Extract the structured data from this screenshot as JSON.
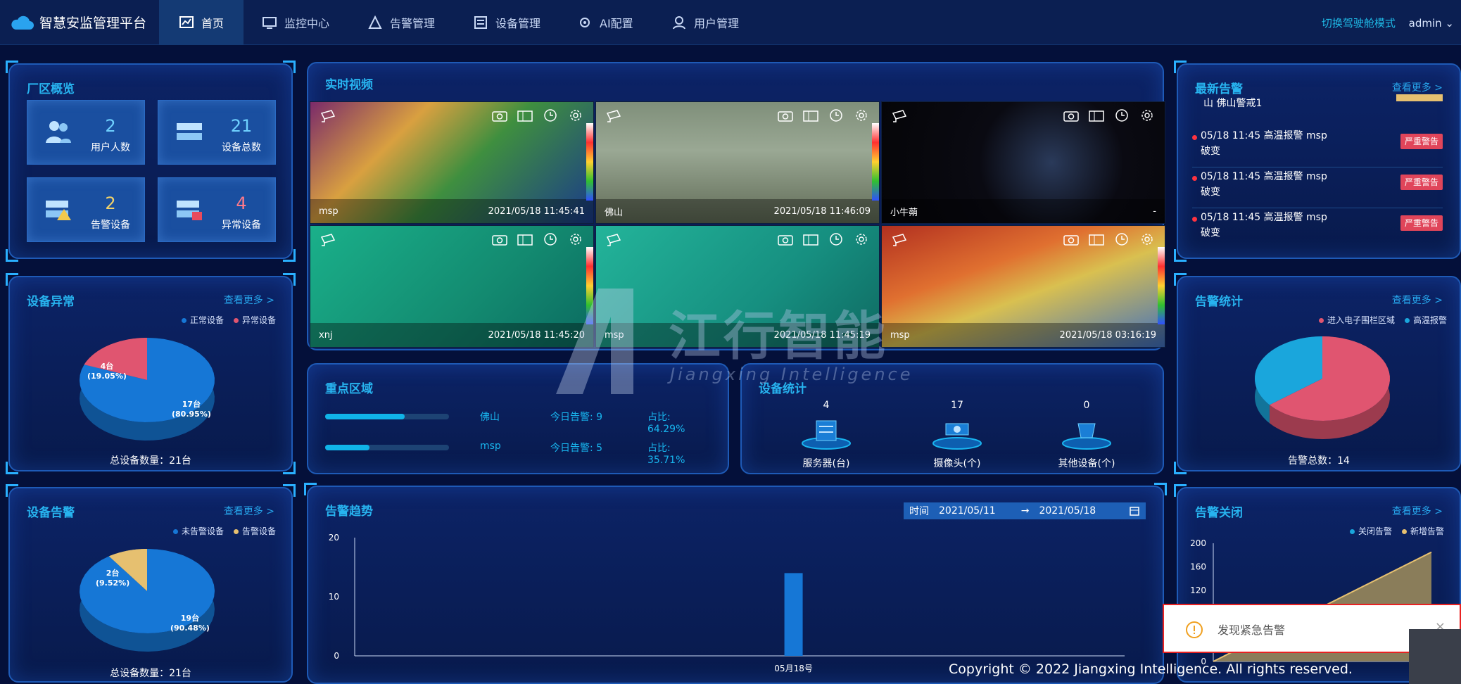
{
  "nav": {
    "brand": "智慧安监管理平台",
    "items": [
      "首页",
      "监控中心",
      "告警管理",
      "设备管理",
      "AI配置",
      "用户管理"
    ],
    "mode_link": "切换驾驶舱模式",
    "user": "admin"
  },
  "factory_overview": {
    "title": "厂区概览",
    "cards": [
      {
        "num": "2",
        "label": "用户人数"
      },
      {
        "num": "21",
        "label": "设备总数"
      },
      {
        "num": "2",
        "label": "告警设备"
      },
      {
        "num": "4",
        "label": "异常设备"
      }
    ]
  },
  "device_abnormal": {
    "title": "设备异常",
    "more": "查看更多 >",
    "legend": [
      "正常设备",
      "异常设备"
    ],
    "slices": [
      {
        "label": "4台",
        "pct": "(19.05%)"
      },
      {
        "label": "17台",
        "pct": "(80.95%)"
      }
    ],
    "total": "总设备数量：21台"
  },
  "device_alarm": {
    "title": "设备告警",
    "more": "查看更多 >",
    "legend": [
      "未告警设备",
      "告警设备"
    ],
    "slices": [
      {
        "label": "2台",
        "pct": "(9.52%)"
      },
      {
        "label": "19台",
        "pct": "(90.48%)"
      }
    ],
    "total": "总设备数量：21台"
  },
  "realtime_video": {
    "title": "实时视频",
    "videos": [
      {
        "name": "msp",
        "time": "2021/05/18 11:45:41"
      },
      {
        "name": "佛山",
        "time": "2021/05/18 11:46:09"
      },
      {
        "name": "小牛蒴",
        "time": "-"
      },
      {
        "name": "xnj",
        "time": "2021/05/18 11:45:20"
      },
      {
        "name": "msp",
        "time": "2021/05/18 11:45:19"
      },
      {
        "name": "msp",
        "time": "2021/05/18 03:16:19"
      }
    ]
  },
  "key_area": {
    "title": "重点区域",
    "rows": [
      {
        "name": "佛山",
        "today": "今日告警: 9",
        "pct": "占比: 64.29%",
        "fill": 0.6429
      },
      {
        "name": "msp",
        "today": "今日告警: 5",
        "pct": "占比: 35.71%",
        "fill": 0.3571
      }
    ]
  },
  "device_stats": {
    "title": "设备统计",
    "items": [
      {
        "num": "4",
        "label": "服务器(台)"
      },
      {
        "num": "17",
        "label": "摄像头(个)"
      },
      {
        "num": "0",
        "label": "其他设备(个)"
      }
    ]
  },
  "alarm_trend": {
    "title": "告警趋势",
    "date_label": "时间",
    "date_from": "2021/05/11",
    "date_arrow": "→",
    "date_to": "2021/05/18"
  },
  "latest_alarm": {
    "title": "最新告警",
    "more": "查看更多 >",
    "top_text": "山 佛山警戒1",
    "items": [
      {
        "line1": "05/18 11:45  高温报警 msp",
        "line2": "破变",
        "tag": "严重警告"
      },
      {
        "line1": "05/18 11:45  高温报警 msp",
        "line2": "破变",
        "tag": "严重警告"
      },
      {
        "line1": "05/18 11:45  高温报警 msp",
        "line2": "破变",
        "tag": "严重警告"
      }
    ]
  },
  "alarm_stats": {
    "title": "告警统计",
    "more": "查看更多 >",
    "legend": [
      "进入电子围栏区域",
      "高温报警"
    ],
    "total": "告警总数：14"
  },
  "alarm_close": {
    "title": "告警关闭",
    "more": "查看更多 >",
    "legend": [
      "关闭告警",
      "新增告警"
    ]
  },
  "toast": {
    "message": "发现紧急告警",
    "close": "×"
  },
  "watermark": {
    "cn": "江行智能",
    "en": "Jiangxing Intelligence"
  },
  "copyright": "Copyright © 2022 Jiangxing Intelligence. All rights reserved.",
  "chart_data": [
    {
      "type": "pie",
      "title": "设备异常",
      "categories": [
        "正常设备",
        "异常设备"
      ],
      "values": [
        17,
        4
      ],
      "colors": [
        "#1677d6",
        "#e05570"
      ]
    },
    {
      "type": "pie",
      "title": "设备告警",
      "categories": [
        "未告警设备",
        "告警设备"
      ],
      "values": [
        19,
        2
      ],
      "colors": [
        "#1677d6",
        "#e6c070"
      ]
    },
    {
      "type": "pie",
      "title": "告警统计",
      "categories": [
        "进入电子围栏区域",
        "高温报警"
      ],
      "values": [
        9,
        5
      ],
      "colors": [
        "#e05570",
        "#1aa6dc"
      ]
    },
    {
      "type": "bar",
      "title": "告警趋势",
      "categories": [
        "05月18号"
      ],
      "values": [
        14
      ],
      "ylim": [
        0,
        20
      ],
      "yticks": [
        "20",
        "10",
        "0"
      ]
    },
    {
      "type": "area",
      "title": "告警关闭",
      "yticks": [
        "200",
        "160",
        "120",
        "0"
      ]
    }
  ]
}
